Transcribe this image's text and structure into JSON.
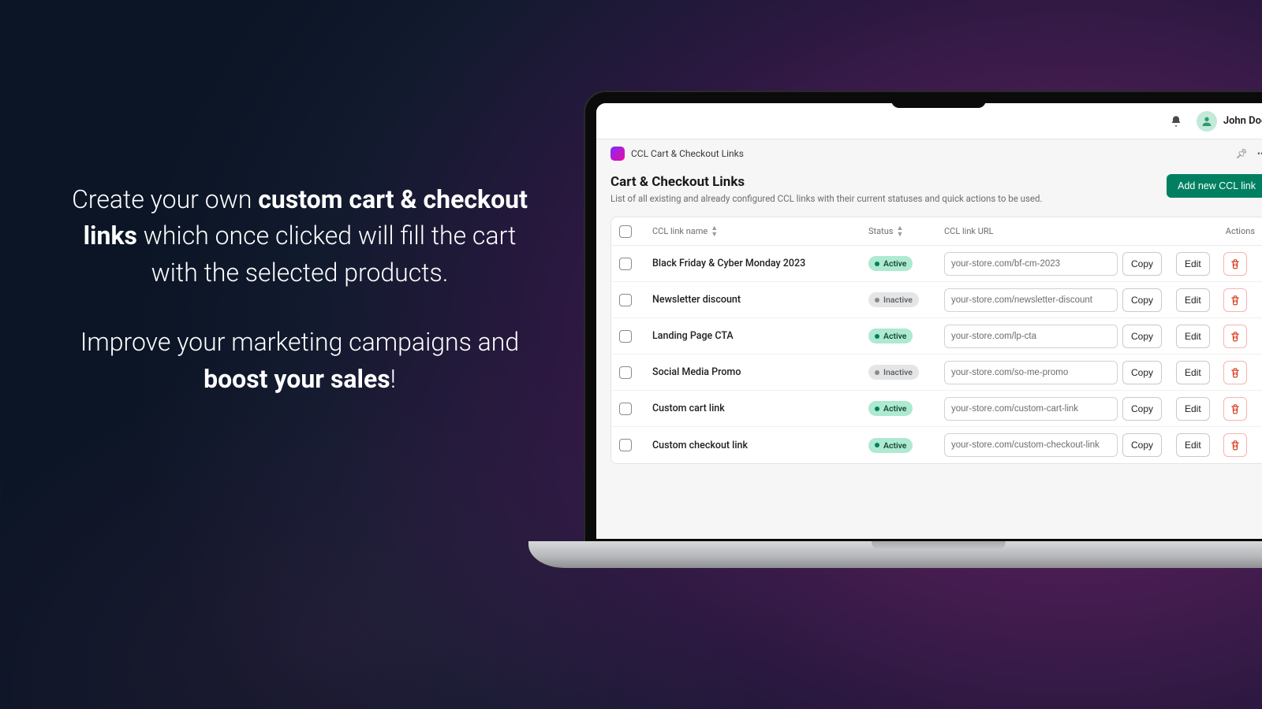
{
  "promo": {
    "p1_pre": "Create your own ",
    "p1_bold": "custom cart & checkout links",
    "p1_post": " which once clicked will fill the cart with the selected products.",
    "p2_pre": "Improve your marketing campaigns and ",
    "p2_bold": "boost your sales",
    "p2_post": "!"
  },
  "topbar": {
    "user_name": "John Doe"
  },
  "crumb": {
    "app_title": "CCL Cart & Checkout Links"
  },
  "page": {
    "title": "Cart & Checkout Links",
    "subtitle": "List of all existing and already configured CCL links with their current statuses and quick actions to be used.",
    "add_button": "Add new CCL link"
  },
  "table": {
    "headers": {
      "name": "CCL link name",
      "status": "Status",
      "url": "CCL link URL",
      "actions": "Actions"
    },
    "copy_label": "Copy",
    "edit_label": "Edit",
    "status_labels": {
      "active": "Active",
      "inactive": "Inactive"
    },
    "rows": [
      {
        "name": "Black Friday & Cyber Monday 2023",
        "status": "active",
        "url": "your-store.com/bf-cm-2023"
      },
      {
        "name": "Newsletter discount",
        "status": "inactive",
        "url": "your-store.com/newsletter-discount"
      },
      {
        "name": "Landing Page CTA",
        "status": "active",
        "url": "your-store.com/lp-cta"
      },
      {
        "name": "Social Media Promo",
        "status": "inactive",
        "url": "your-store.com/so-me-promo"
      },
      {
        "name": "Custom cart link",
        "status": "active",
        "url": "your-store.com/custom-cart-link"
      },
      {
        "name": "Custom checkout link",
        "status": "active",
        "url": "your-store.com/custom-checkout-link"
      }
    ]
  }
}
